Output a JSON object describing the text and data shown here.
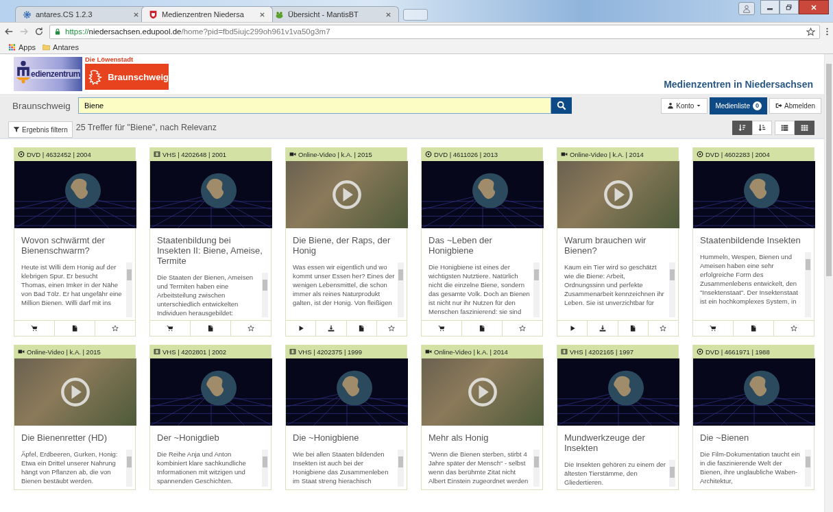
{
  "browser": {
    "tabs": [
      {
        "kind": "gear",
        "title": "antares.CS 1.2.3",
        "selected": false
      },
      {
        "kind": "crest",
        "title": "Medienzentren Niedersa",
        "selected": true
      },
      {
        "kind": "frog",
        "title": "Übersicht - MantisBT",
        "selected": false
      }
    ],
    "address_bar": {
      "scheme": "https://",
      "host": "niedersachsen.edupool.de",
      "path": "/home?pid=fbd5iujc299oh961v1va50g3m7"
    },
    "bookmarks": [
      {
        "kind": "apps",
        "label": "Apps"
      },
      {
        "kind": "folder",
        "label": "Antares"
      }
    ]
  },
  "header": {
    "logo_text": "edienzentrum",
    "city_tagline": "Die Löwenstadt",
    "city_name": "Braunschweig",
    "portal_title": "Medienzentren in Niedersachsen"
  },
  "search": {
    "location": "Braunschweig",
    "value": "Biene"
  },
  "account": {
    "konto": "Konto",
    "medienliste": "Medienliste",
    "medienliste_count": "0",
    "abmelden": "Abmelden"
  },
  "results": {
    "filter_button": "Ergebnis filtern",
    "summary": "25 Treffer für \"Biene\", nach Relevanz",
    "sort_buttons": [
      {
        "selected": true
      },
      {
        "selected": false
      }
    ],
    "view_buttons": [
      {
        "selected": false
      },
      {
        "selected": true
      }
    ],
    "cards": [
      {
        "kind": "dvd",
        "info": "DVD | 4632452 | 2004",
        "title": "Wovon schwärmt der Bienenschwarm?",
        "description": "Heute ist Willi dem Honig auf der klebrigen Spur. Er besucht Thomas, einen Imker in der Nähe von Bad Tölz. Er hat ungefähr eine Million Bienen. Willi darf mit ins",
        "toolbar": true
      },
      {
        "kind": "vhs",
        "info": "VHS | 4202648 | 2001",
        "title": "Staatenbildung bei Insekten II: Biene, Ameise, Termite",
        "description": "Die Staaten der Bienen, Ameisen und Termiten haben eine Arbeitsteilung zwischen unterschiedlich entwickelten Individuen herausgebildet:",
        "toolbar": true
      },
      {
        "kind": "video",
        "info": "Online-Video | k.A. | 2015",
        "title": "Die Biene, der Raps, der Honig",
        "description": "Was essen wir eigentlich und wo kommt unser Essen her? Eines der wenigen Lebensmittel, die schon immer als reines Naturprodukt galten, ist der Honig. Von fleißigen",
        "toolbar": true
      },
      {
        "kind": "dvd",
        "info": "DVD | 4611026 | 2013",
        "title": "Das ~Leben der Honigbiene",
        "description": "Die Honigbiene ist eines der wichtigsten Nutztiere. Natürlich nicht die einzelne Biene, sondern das gesamte Volk. Doch an Bienen ist nicht nur ihr Nutzen für den Menschen faszinierend: sie sind",
        "toolbar": true
      },
      {
        "kind": "video",
        "info": "Online-Video | k.A. | 2014",
        "title": "Warum brauchen wir Bienen?",
        "description": "Kaum ein Tier wird so geschätzt wie die Biene: Arbeit, Ordnungssinn und perfekte Zusammenarbeit kennzeichnen ihr Leben. Sie ist unverzichtbar für",
        "toolbar": true
      },
      {
        "kind": "dvd",
        "info": "DVD | 4602283 | 2004",
        "title": "Staatenbildende Insekten",
        "description": "Hummeln, Wespen, Bienen und Ameisen haben eine sehr erfolgreiche Form des Zusammenlebens entwickelt, den \"Insektenstaat\". Der Insektenstaat ist ein hochkomplexes System, in",
        "toolbar": true
      },
      {
        "kind": "video",
        "info": "Online-Video | k.A. | 2015",
        "title": "Die Bienenretter (HD)",
        "description": "Äpfel, Erdbeeren, Gurken, Honig: Etwa ein Drittel unserer Nahrung hängt von Pflanzen ab, die von Bienen bestäubt werden.",
        "toolbar": false
      },
      {
        "kind": "vhs",
        "info": "VHS | 4202801 | 2002",
        "title": "Der ~Honigdieb",
        "description": "Die Reihe Anja und Anton kombiniert klare sachkundliche Informationen mit witzigen und spannenden Geschichten.",
        "toolbar": false
      },
      {
        "kind": "vhs",
        "info": "VHS | 4202375 | 1999",
        "title": "Die ~Honigbiene",
        "description": "Wie bei allen Staaten bildenden Insekten ist auch bei der Honigbiene das Zusammenleben im Staat streng hierachisch",
        "toolbar": false
      },
      {
        "kind": "video",
        "info": "Online-Video | k.A. | 2014",
        "title": "Mehr als Honig",
        "description": "\"Wenn die Bienen sterben, stirbt 4 Jahre später der Mensch“ - selbst wenn das berühmte Zitat nicht Albert Einstein zugeordnet werden",
        "toolbar": false
      },
      {
        "kind": "vhs",
        "info": "VHS | 4202165 | 1997",
        "title": "Mundwerkzeuge der Insekten",
        "description": "Die Insekten gehören zu einem der ältesten Tierstämme, den Gliedertieren.",
        "toolbar": false
      },
      {
        "kind": "dvd",
        "info": "DVD | 4661971 | 1988",
        "title": "Die ~Bienen",
        "description": "Die Film-Dokumentation taucht ein in die faszinierende Welt der Bienen, ihre unglaubliche Waben-Architektur,",
        "toolbar": false
      }
    ]
  }
}
